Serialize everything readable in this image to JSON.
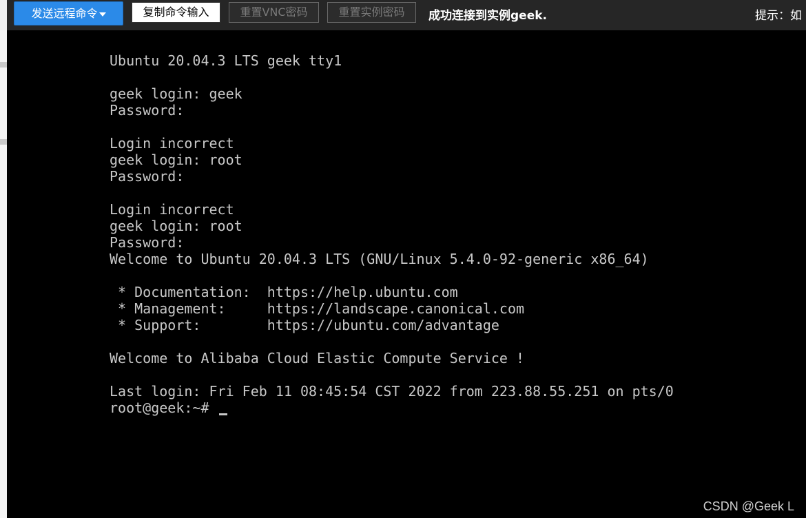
{
  "toolbar": {
    "send_remote_command_label": "发送远程命令",
    "copy_command_input_label": "复制命令输入",
    "reset_vnc_password_label": "重置VNC密码",
    "reset_instance_password_label": "重置实例密码",
    "status_message": "成功连接到实例geek.",
    "hint_prefix": "提示：如"
  },
  "terminal": {
    "lines": [
      "Ubuntu 20.04.3 LTS geek tty1",
      "",
      "geek login: geek",
      "Password:",
      "",
      "Login incorrect",
      "geek login: root",
      "Password:",
      "",
      "Login incorrect",
      "geek login: root",
      "Password:",
      "Welcome to Ubuntu 20.04.3 LTS (GNU/Linux 5.4.0-92-generic x86_64)",
      "",
      " * Documentation:  https://help.ubuntu.com",
      " * Management:     https://landscape.canonical.com",
      " * Support:        https://ubuntu.com/advantage",
      "",
      "Welcome to Alibaba Cloud Elastic Compute Service !",
      "",
      "Last login: Fri Feb 11 08:45:54 CST 2022 from 223.88.55.251 on pts/0"
    ],
    "prompt": "root@geek:~# "
  },
  "watermark": "CSDN @Geek L",
  "colors": {
    "toolbar_bg": "#262626",
    "primary_button": "#2b8ae8",
    "terminal_bg": "#000000",
    "terminal_text": "#c8c8c8"
  }
}
